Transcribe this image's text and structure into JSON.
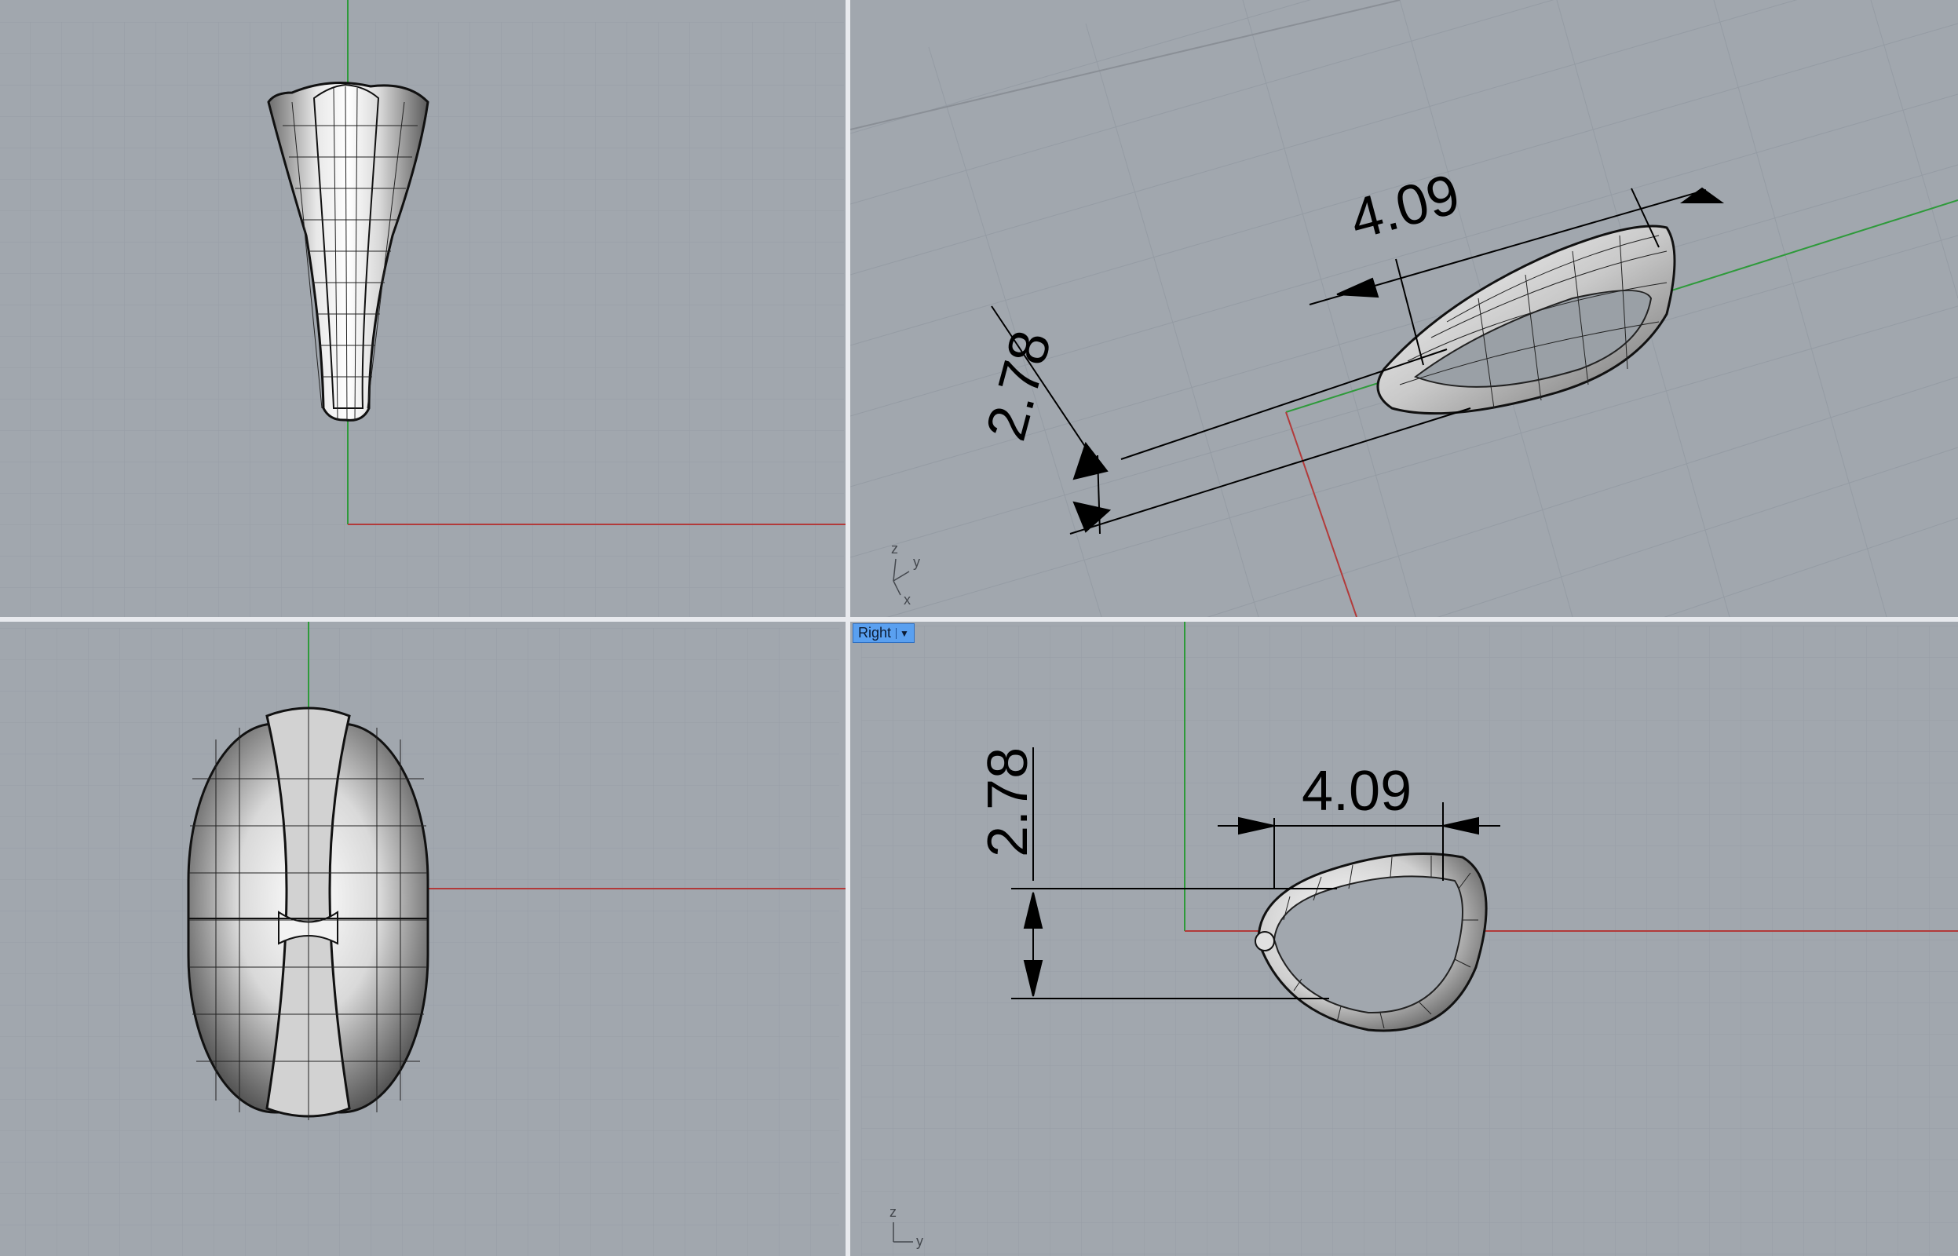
{
  "viewports": {
    "top": {
      "label": ""
    },
    "perspective": {
      "label": "",
      "dim_width": "4.09",
      "dim_height": "2.78",
      "axis_z": "z",
      "axis_y": "y",
      "axis_x": "x"
    },
    "front": {
      "label": ""
    },
    "right": {
      "label": "Right",
      "dim_width": "4.09",
      "dim_height": "2.78",
      "axis_z": "z",
      "axis_y": "y"
    }
  },
  "colors": {
    "background": "#a1a7ae",
    "grid_minor": "#98a0a8",
    "grid_major": "#8c939b",
    "x_axis": "#b23a3a",
    "y_axis": "#2e9a3a",
    "label_active": "#5aa0f0"
  }
}
